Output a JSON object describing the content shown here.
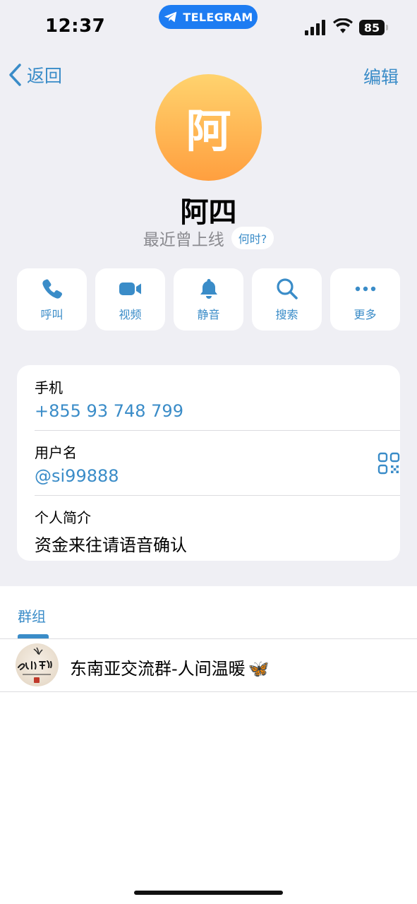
{
  "status_bar": {
    "time": "12:37",
    "app_pill": "TELEGRAM",
    "battery": "85"
  },
  "nav": {
    "back_label": "返回",
    "edit_label": "编辑"
  },
  "profile": {
    "avatar_initial": "阿",
    "name": "阿四",
    "last_seen": "最近曾上线",
    "when_chip": "何时?"
  },
  "actions": [
    {
      "label": "呼叫",
      "icon": "phone-icon"
    },
    {
      "label": "视频",
      "icon": "video-icon"
    },
    {
      "label": "静音",
      "icon": "bell-icon"
    },
    {
      "label": "搜索",
      "icon": "search-icon"
    },
    {
      "label": "更多",
      "icon": "more-icon"
    }
  ],
  "info": {
    "phone_label": "手机",
    "phone_value": "+855 93 748 799",
    "username_label": "用户名",
    "username_value": "@si99888",
    "bio_label": "个人简介",
    "bio_value": "资金来往请语音确认"
  },
  "groups": {
    "tab_label": "群组",
    "items": [
      {
        "name": "东南亚交流群-人间温暖",
        "emoji": "🦋"
      }
    ]
  },
  "colors": {
    "accent": "#3a8cc8",
    "avatar_top": "#ffd36e",
    "avatar_bottom": "#ff9f3f",
    "telegram_pill": "#1d7cf2"
  }
}
